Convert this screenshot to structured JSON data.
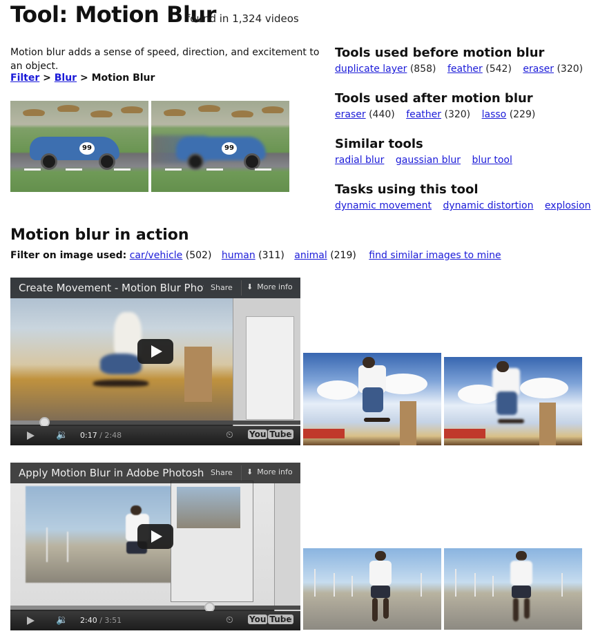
{
  "header": {
    "title": "Tool: Motion Blur",
    "found": "found in 1,324 videos"
  },
  "intro": {
    "description": "Motion blur adds a sense of speed, direction, and excitement to an object.",
    "breadcrumb": {
      "root": "Filter",
      "sep1": ">",
      "parent": "Blur",
      "sep2": ">",
      "current": "Motion Blur"
    }
  },
  "sidebar": {
    "before": {
      "heading": "Tools used before motion blur",
      "items": [
        {
          "label": "duplicate layer",
          "count": "(858)"
        },
        {
          "label": "feather",
          "count": "(542)"
        },
        {
          "label": "eraser",
          "count": "(320)"
        }
      ]
    },
    "after": {
      "heading": "Tools used after motion blur",
      "items": [
        {
          "label": "eraser",
          "count": "(440)"
        },
        {
          "label": "feather",
          "count": "(320)"
        },
        {
          "label": "lasso",
          "count": "(229)"
        }
      ]
    },
    "similar": {
      "heading": "Similar tools",
      "items": [
        {
          "label": "radial blur"
        },
        {
          "label": "gaussian blur"
        },
        {
          "label": "blur tool"
        }
      ]
    },
    "tasks": {
      "heading": "Tasks using this tool",
      "items": [
        {
          "label": "dynamic movement"
        },
        {
          "label": "dynamic distortion"
        },
        {
          "label": "explosion"
        }
      ]
    }
  },
  "action": {
    "heading": "Motion blur in action",
    "filter_label": "Filter on image used:",
    "filters": [
      {
        "label": "car/vehicle",
        "count": "(502)"
      },
      {
        "label": "human",
        "count": "(311)"
      },
      {
        "label": "animal",
        "count": "(219)"
      }
    ],
    "find_similar": "find similar images to mine"
  },
  "videos": [
    {
      "title": "Create Movement - Motion Blur Photo",
      "share": "Share",
      "more_info": "More info",
      "current_time": "0:17",
      "duration": "/ 2:48",
      "progress": 0.12
    },
    {
      "title": "Apply Motion Blur in Adobe Photoshop",
      "share": "Share",
      "more_info": "More info",
      "current_time": "2:40",
      "duration": "/ 3:51",
      "progress": 0.69
    }
  ],
  "car_number": "99",
  "player_logo": {
    "you": "You",
    "tube": "Tube"
  },
  "icons": {
    "play": "play-icon",
    "volume": "volume-icon",
    "clock": "watch-later-icon",
    "fullscreen": "fullscreen-icon",
    "more_info_arrow": "chevron-down-icon"
  },
  "colors": {
    "link": "#1a1ad8",
    "player_bg": "#1c1c1c"
  }
}
